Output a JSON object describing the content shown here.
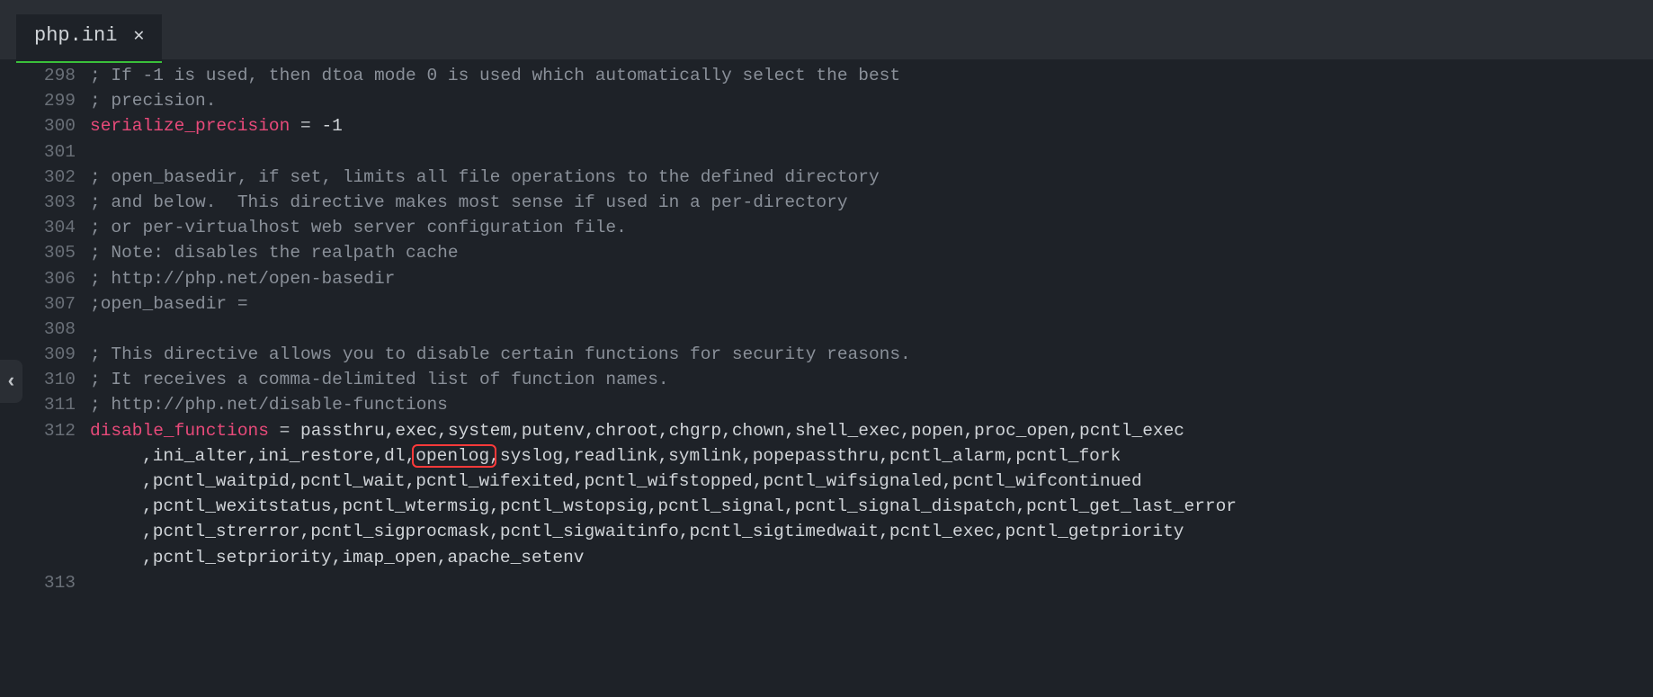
{
  "tab": {
    "filename": "php.ini"
  },
  "lines": [
    {
      "num": "298",
      "type": "comment",
      "text": "; If -1 is used, then dtoa mode 0 is used which automatically select the best"
    },
    {
      "num": "299",
      "type": "comment",
      "text": "; precision."
    },
    {
      "num": "300",
      "type": "setting",
      "key": "serialize_precision",
      "eq": " = ",
      "value": "-1"
    },
    {
      "num": "301",
      "type": "blank",
      "text": ""
    },
    {
      "num": "302",
      "type": "comment",
      "text": "; open_basedir, if set, limits all file operations to the defined directory"
    },
    {
      "num": "303",
      "type": "comment",
      "text": "; and below.  This directive makes most sense if used in a per-directory"
    },
    {
      "num": "304",
      "type": "comment",
      "text": "; or per-virtualhost web server configuration file."
    },
    {
      "num": "305",
      "type": "comment",
      "text": "; Note: disables the realpath cache"
    },
    {
      "num": "306",
      "type": "comment",
      "text": "; http://php.net/open-basedir"
    },
    {
      "num": "307",
      "type": "comment",
      "text": ";open_basedir ="
    },
    {
      "num": "308",
      "type": "blank",
      "text": ""
    },
    {
      "num": "309",
      "type": "comment",
      "text": "; This directive allows you to disable certain functions for security reasons."
    },
    {
      "num": "310",
      "type": "comment",
      "text": "; It receives a comma-delimited list of function names."
    },
    {
      "num": "311",
      "type": "comment",
      "text": "; http://php.net/disable-functions"
    },
    {
      "num": "312",
      "type": "setting",
      "key": "disable_functions",
      "eq": " = ",
      "value": "passthru,exec,system,putenv,chroot,chgrp,chown,shell_exec,popen,proc_open,pcntl_exec"
    },
    {
      "num": "",
      "type": "wrap",
      "text": ",ini_alter,ini_restore,dl,openlog,syslog,readlink,symlink,popepassthru,pcntl_alarm,pcntl_fork"
    },
    {
      "num": "",
      "type": "wrap",
      "text": ",pcntl_waitpid,pcntl_wait,pcntl_wifexited,pcntl_wifstopped,pcntl_wifsignaled,pcntl_wifcontinued"
    },
    {
      "num": "",
      "type": "wrap",
      "text": ",pcntl_wexitstatus,pcntl_wtermsig,pcntl_wstopsig,pcntl_signal,pcntl_signal_dispatch,pcntl_get_last_error"
    },
    {
      "num": "",
      "type": "wrap",
      "text": ",pcntl_strerror,pcntl_sigprocmask,pcntl_sigwaitinfo,pcntl_sigtimedwait,pcntl_exec,pcntl_getpriority"
    },
    {
      "num": "",
      "type": "wrap",
      "text": ",pcntl_setpriority,imap_open,apache_setenv"
    },
    {
      "num": "313",
      "type": "blank",
      "text": ""
    }
  ],
  "highlight": {
    "text": "openlog"
  },
  "toggle": {
    "glyph": "‹"
  }
}
